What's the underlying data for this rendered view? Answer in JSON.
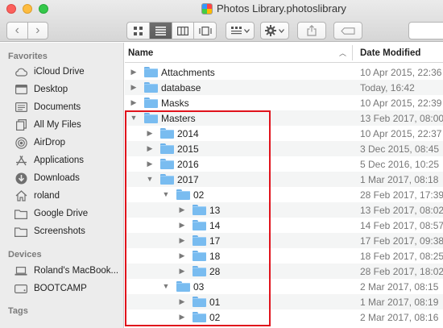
{
  "window": {
    "title": "Photos Library.photoslibrary"
  },
  "toolbar": {
    "back_glyph": "‹",
    "forward_glyph": "›",
    "views": [
      "icon-view",
      "list-view",
      "column-view",
      "cover-flow-view"
    ],
    "active_view": "list-view"
  },
  "sidebar": {
    "favorites_heading": "Favorites",
    "favorites": [
      {
        "label": "iCloud Drive",
        "icon": "cloud-icon"
      },
      {
        "label": "Desktop",
        "icon": "desktop-icon"
      },
      {
        "label": "Documents",
        "icon": "documents-icon"
      },
      {
        "label": "All My Files",
        "icon": "all-files-icon"
      },
      {
        "label": "AirDrop",
        "icon": "airdrop-icon"
      },
      {
        "label": "Applications",
        "icon": "applications-icon"
      },
      {
        "label": "Downloads",
        "icon": "downloads-icon"
      },
      {
        "label": "roland",
        "icon": "home-icon"
      },
      {
        "label": "Google Drive",
        "icon": "folder-icon"
      },
      {
        "label": "Screenshots",
        "icon": "folder-icon"
      }
    ],
    "devices_heading": "Devices",
    "devices": [
      {
        "label": "Roland's MacBook...",
        "icon": "laptop-icon"
      },
      {
        "label": "BOOTCAMP",
        "icon": "disk-icon"
      }
    ],
    "tags_heading": "Tags"
  },
  "columns": {
    "name": "Name",
    "date_modified": "Date Modified"
  },
  "rows": [
    {
      "name": "Attachments",
      "date": "10 Apr 2015, 22:36",
      "expanded": false
    },
    {
      "name": "database",
      "date": "Today, 16:42",
      "expanded": false
    },
    {
      "name": "Masks",
      "date": "10 Apr 2015, 22:39",
      "expanded": false
    },
    {
      "name": "Masters",
      "date": "13 Feb 2017, 08:00",
      "expanded": true
    },
    {
      "name": "2014",
      "date": "10 Apr 2015, 22:37",
      "expanded": false
    },
    {
      "name": "2015",
      "date": "3 Dec 2015, 08:45",
      "expanded": false
    },
    {
      "name": "2016",
      "date": "5 Dec 2016, 10:25",
      "expanded": false
    },
    {
      "name": "2017",
      "date": "1 Mar 2017, 08:18",
      "expanded": true
    },
    {
      "name": "02",
      "date": "28 Feb 2017, 17:39",
      "expanded": true
    },
    {
      "name": "13",
      "date": "13 Feb 2017, 08:02",
      "expanded": false
    },
    {
      "name": "14",
      "date": "14 Feb 2017, 08:57",
      "expanded": false
    },
    {
      "name": "17",
      "date": "17 Feb 2017, 09:38",
      "expanded": false
    },
    {
      "name": "18",
      "date": "18 Feb 2017, 08:25",
      "expanded": false
    },
    {
      "name": "28",
      "date": "28 Feb 2017, 18:02",
      "expanded": false
    },
    {
      "name": "03",
      "date": "2 Mar 2017, 08:15",
      "expanded": true
    },
    {
      "name": "01",
      "date": "1 Mar 2017, 08:19",
      "expanded": false
    },
    {
      "name": "02",
      "date": "2 Mar 2017, 08:16",
      "expanded": false
    }
  ]
}
